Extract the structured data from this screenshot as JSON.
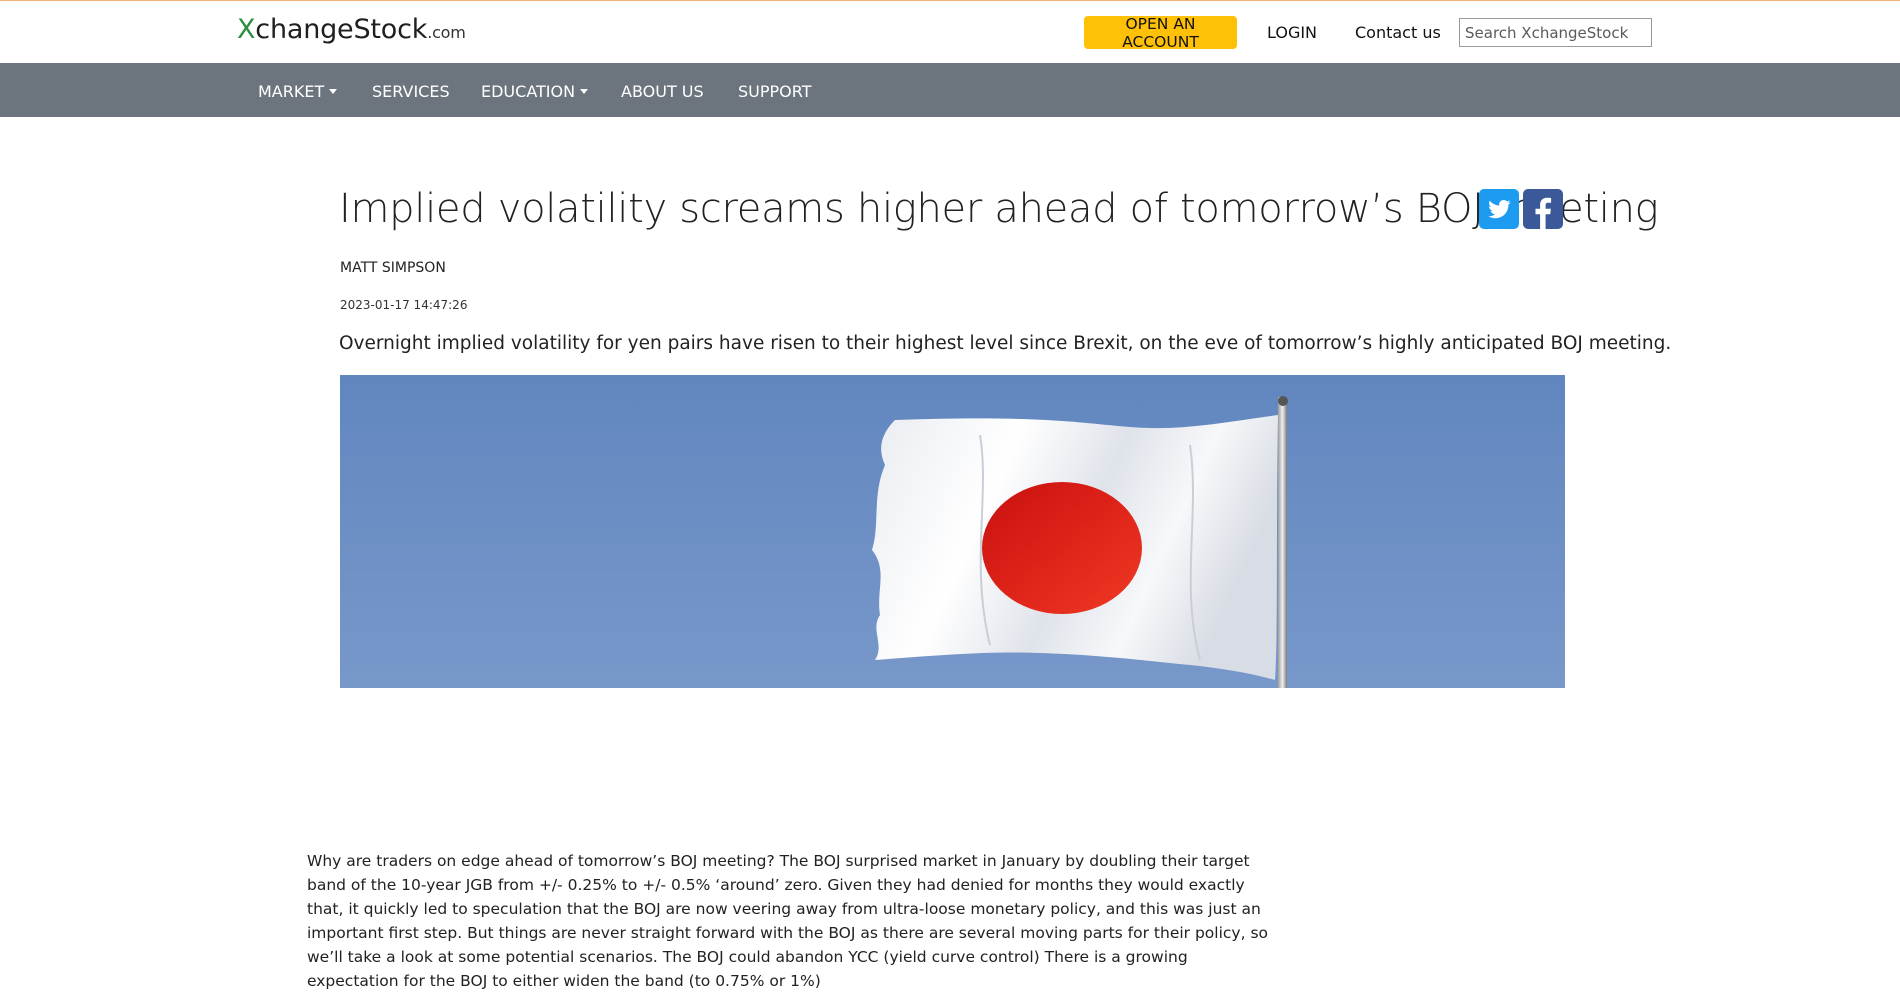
{
  "header": {
    "logo": {
      "x": "X",
      "name": "changeStock",
      "tld": ".com"
    },
    "open_account": "OPEN AN ACCOUNT",
    "login": "LOGIN",
    "contact": "Contact us",
    "search_placeholder": "Search XchangeStock"
  },
  "nav": {
    "items": [
      {
        "label": "MARKET",
        "dropdown": true
      },
      {
        "label": "SERVICES",
        "dropdown": false
      },
      {
        "label": "EDUCATION",
        "dropdown": true
      },
      {
        "label": "ABOUT US",
        "dropdown": false
      },
      {
        "label": "SUPPORT",
        "dropdown": false
      }
    ]
  },
  "article": {
    "title": "Implied volatility screams higher ahead of tomorrow’s BOJ meeting",
    "author": "MATT SIMPSON",
    "date": "2023-01-17 14:47:26",
    "lede": "Overnight implied volatility for yen pairs have risen to their highest level since Brexit, on the eve of tomorrow’s highly anticipated BOJ meeting.",
    "body": "Why are traders on edge ahead of tomorrow’s BOJ meeting? The BOJ surprised market in January by doubling their target band of the 10-year JGB from +/- 0.25% to +/- 0.5% ‘around’ zero. Given they had denied for months they would exactly that, it quickly led to speculation that the BOJ are now veering away from ultra-loose monetary policy, and this was just an important first step. But things are never straight forward with the BOJ as there are several moving parts for their policy, so we’ll take a look at some potential scenarios. The BOJ could abandon YCC (yield curve control) There is a growing expectation for the BOJ to either widen the band (to 0.75% or 1%)"
  },
  "social": {
    "twitter_icon": "twitter-icon",
    "facebook_icon": "facebook-icon"
  },
  "colors": {
    "accent": "#ffc107",
    "nav_bg": "#6c757d",
    "logo_x": "#2a8f3d",
    "twitter": "#1d9bf0",
    "facebook": "#3b5998"
  }
}
